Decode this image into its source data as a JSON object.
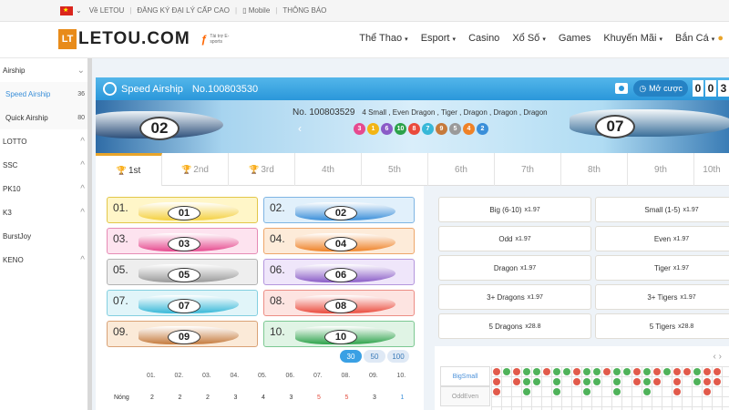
{
  "topbar": {
    "items": [
      "Về LETOU",
      "ĐĂNG KÝ ĐẠI LÝ CẤP CAO",
      "Mobile",
      "THÔNG BÁO"
    ]
  },
  "logo": {
    "text": "LETOU.COM",
    "badge": "LT",
    "partner_sub": "Tài trợ E-sports"
  },
  "nav": [
    "Thể Thao",
    "Esport",
    "Casino",
    "Xổ Số",
    "Games",
    "Khuyến Mãi",
    "Bắn Cá"
  ],
  "sidebar": [
    {
      "label": "Airship",
      "chev": "⌄"
    },
    {
      "label": "Speed Airship",
      "count": "36"
    },
    {
      "label": "Quick Airship",
      "count": "80"
    },
    {
      "label": "LOTTO",
      "chev": "^"
    },
    {
      "label": "SSC",
      "chev": "^"
    },
    {
      "label": "PK10",
      "chev": "^"
    },
    {
      "label": "K3",
      "chev": "^"
    },
    {
      "label": "BurstJoy"
    },
    {
      "label": "KENO",
      "chev": "^"
    }
  ],
  "game": {
    "title": "Speed Airship",
    "issue": "No.100803530",
    "mode": "Mở cược",
    "digits": [
      "0",
      "0",
      "3"
    ]
  },
  "banner": {
    "issue": "No. 100803529",
    "summary": "4 Small , Even Dragon , Tiger , Dragon , Dragon , Dragon",
    "left_boat": "02",
    "right_boat": "07",
    "balls": [
      {
        "n": "3",
        "c": "#e64a8f"
      },
      {
        "n": "1",
        "c": "#f2b515"
      },
      {
        "n": "6",
        "c": "#8a5cc7"
      },
      {
        "n": "10",
        "c": "#2ca24a"
      },
      {
        "n": "8",
        "c": "#ea4b3c"
      },
      {
        "n": "7",
        "c": "#37b8d8"
      },
      {
        "n": "9",
        "c": "#c57a3c"
      },
      {
        "n": "5",
        "c": "#9a9a9a"
      },
      {
        "n": "4",
        "c": "#ef8227"
      },
      {
        "n": "2",
        "c": "#3a8fd9"
      }
    ]
  },
  "tabs": [
    "1st",
    "2nd",
    "3rd",
    "4th",
    "5th",
    "6th",
    "7th",
    "8th",
    "9th",
    "10th"
  ],
  "lanes": [
    {
      "num": "01.",
      "boat": "01",
      "bg": "#fff6c8",
      "border": "#e2c74a",
      "color": "#f4d03f"
    },
    {
      "num": "02.",
      "boat": "02",
      "bg": "#e1f0fb",
      "border": "#7fb5e3",
      "color": "#3a8fd9"
    },
    {
      "num": "03.",
      "boat": "03",
      "bg": "#fde3ef",
      "border": "#e68bb5",
      "color": "#e64a8f"
    },
    {
      "num": "04.",
      "boat": "04",
      "bg": "#fdebd9",
      "border": "#eea66a",
      "color": "#ef8227"
    },
    {
      "num": "05.",
      "boat": "05",
      "bg": "#eeeeee",
      "border": "#b3b3b3",
      "color": "#9a9a9a"
    },
    {
      "num": "06.",
      "boat": "06",
      "bg": "#efe6fa",
      "border": "#b496dd",
      "color": "#8a5cc7"
    },
    {
      "num": "07.",
      "boat": "07",
      "bg": "#e1f5f9",
      "border": "#83cfe0",
      "color": "#37b8d8"
    },
    {
      "num": "08.",
      "boat": "08",
      "bg": "#fde4e1",
      "border": "#ec8d85",
      "color": "#ea4b3c"
    },
    {
      "num": "09.",
      "boat": "09",
      "bg": "#fbead8",
      "border": "#d9a276",
      "color": "#c57a3c"
    },
    {
      "num": "10.",
      "boat": "10",
      "bg": "#e0f4e5",
      "border": "#7cc892",
      "color": "#2ca24a"
    }
  ],
  "chips": [
    "30",
    "50",
    "100"
  ],
  "stats": {
    "cols": [
      "01.",
      "02.",
      "03.",
      "04.",
      "05.",
      "06.",
      "07.",
      "08.",
      "09.",
      "10."
    ],
    "row_label": "Nóng",
    "values": [
      "2",
      "2",
      "2",
      "3",
      "4",
      "3",
      "5",
      "5",
      "3",
      "1"
    ]
  },
  "options": [
    {
      "label": "Big (6-10)",
      "mult": "x1.97"
    },
    {
      "label": "Small (1-5)",
      "mult": "x1.97"
    },
    {
      "label": "Odd",
      "mult": "x1.97"
    },
    {
      "label": "Even",
      "mult": "x1.97"
    },
    {
      "label": "Dragon",
      "mult": "x1.97"
    },
    {
      "label": "Tiger",
      "mult": "x1.97"
    },
    {
      "label": "3+ Dragons",
      "mult": "x1.97"
    },
    {
      "label": "3+ Tigers",
      "mult": "x1.97"
    },
    {
      "label": "5 Dragons",
      "mult": "x28.8"
    },
    {
      "label": "5 Tigers",
      "mult": "x28.8"
    }
  ],
  "road": {
    "tabs": [
      "BigSmall",
      "OddEven"
    ],
    "arrows": "‹   ›"
  }
}
